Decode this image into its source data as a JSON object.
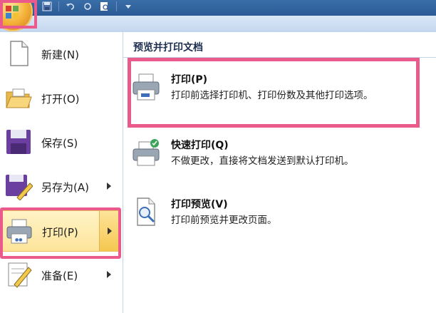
{
  "titlebar": {
    "qat": [
      "save-icon",
      "undo-icon",
      "redo-icon",
      "print-preview-icon",
      "customize-arrow-icon"
    ]
  },
  "leftmenu": {
    "items": [
      {
        "label": "新建(N)",
        "icon": "new-document-icon",
        "submenu": false
      },
      {
        "label": "打开(O)",
        "icon": "open-folder-icon",
        "submenu": false
      },
      {
        "label": "保存(S)",
        "icon": "save-icon",
        "submenu": false
      },
      {
        "label": "另存为(A)",
        "icon": "save-as-icon",
        "submenu": true
      },
      {
        "label": "打印(P)",
        "icon": "printer-icon",
        "submenu": true,
        "active": true
      },
      {
        "label": "准备(E)",
        "icon": "prepare-icon",
        "submenu": true
      }
    ]
  },
  "panel": {
    "header": "预览并打印文档",
    "options": [
      {
        "title": "打印(P)",
        "desc": "打印前选择打印机、打印份数及其他打印选项。",
        "icon": "printer-icon"
      },
      {
        "title": "快速打印(Q)",
        "desc": "不做更改，直接将文档发送到默认打印机。",
        "icon": "quick-print-icon"
      },
      {
        "title": "打印预览(V)",
        "desc": "打印前预览并更改页面。",
        "icon": "print-preview-icon"
      }
    ]
  },
  "colors": {
    "highlight": "#ea5a8c",
    "active_bg": "#fde49a",
    "titlebar": "#2b5b95"
  }
}
